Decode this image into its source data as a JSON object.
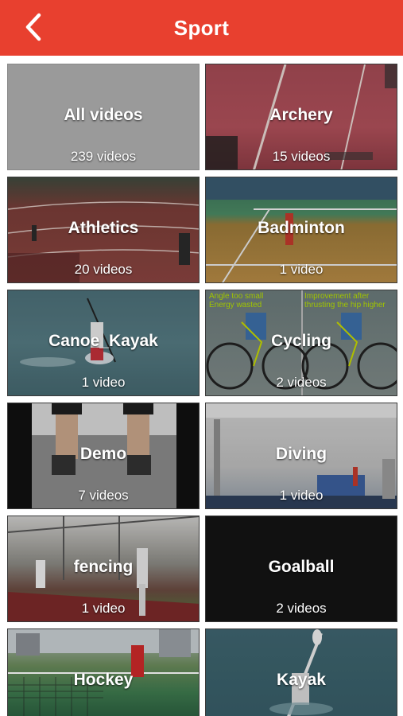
{
  "header": {
    "title": "Sport",
    "back_icon": "chevron-left-icon",
    "color": "#e8402f"
  },
  "categories": [
    {
      "name": "All videos",
      "count": "239 videos"
    },
    {
      "name": "Archery",
      "count": "15 videos"
    },
    {
      "name": "Athletics",
      "count": "20 videos"
    },
    {
      "name": "Badminton",
      "count": "1 video"
    },
    {
      "name": "Canoe_Kayak",
      "count": "1 video"
    },
    {
      "name": "Cycling",
      "count": "2 videos"
    },
    {
      "name": "Demo",
      "count": "7 videos"
    },
    {
      "name": "Diving",
      "count": "1 video"
    },
    {
      "name": "fencing",
      "count": "1 video"
    },
    {
      "name": "Goalball",
      "count": "2 videos"
    },
    {
      "name": "Hockey",
      "count": ""
    },
    {
      "name": "Kayak",
      "count": ""
    }
  ],
  "cycling_overlay": {
    "left_note": "Angle too small\nEnergy wasted",
    "right_note": "Improvement after\nthrusting the hip higher"
  }
}
